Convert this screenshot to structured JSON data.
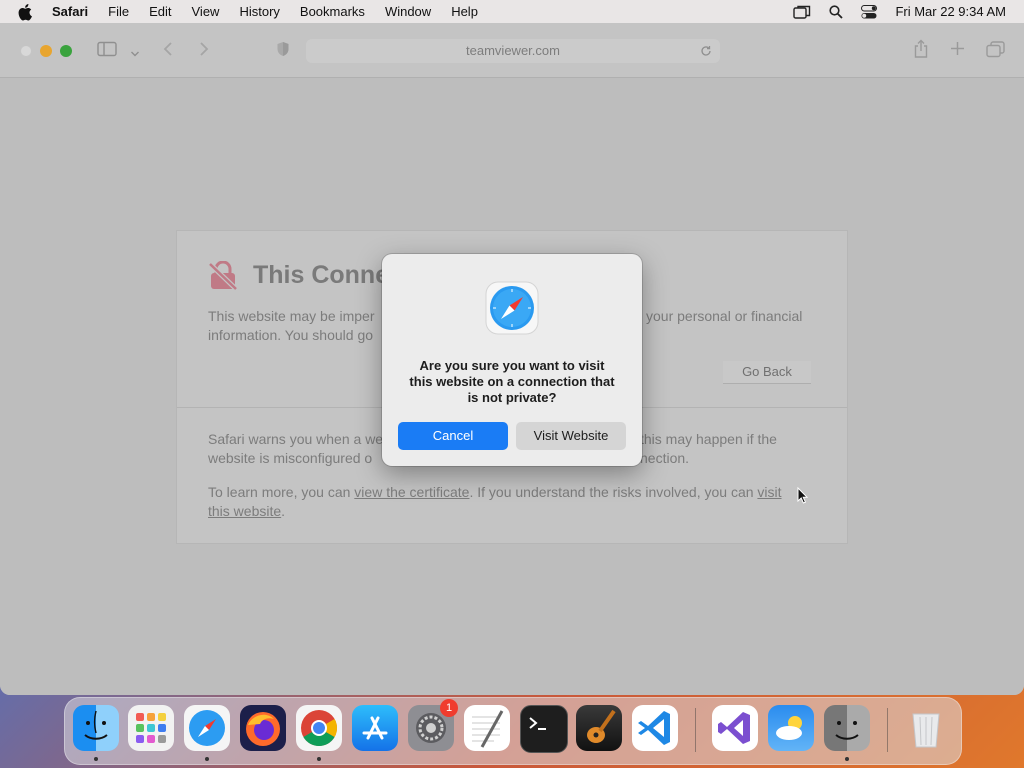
{
  "menubar": {
    "app_name": "Safari",
    "items": [
      "File",
      "Edit",
      "View",
      "History",
      "Bookmarks",
      "Window",
      "Help"
    ],
    "clock": "Fri Mar 22  9:34 AM"
  },
  "toolbar": {
    "address": "teamviewer.com"
  },
  "warning_page": {
    "title": "This Conne",
    "para1_line1_left": "This website may be imper",
    "para1_line1_right": "your personal or financial",
    "para1_line2_left": "information. You should go",
    "go_back_label": "Go Back",
    "para2_line1_left": "Safari warns you when a we",
    "para2_line1_right": "this may happen if the",
    "para2_line2_left": "website is misconfigured o",
    "para2_line2_right": "nection.",
    "learn_prefix": "To learn more, you can ",
    "view_cert_link": "view the certificate",
    "learn_middle": ". If you understand the risks involved, you can ",
    "visit_link_part1": "visit",
    "visit_link_part2": "this website",
    "learn_suffix": "."
  },
  "dialog": {
    "message_line1": "Are you sure you want to visit",
    "message_line2": "this website on a connection that",
    "message_line3": "is not private?",
    "cancel_label": "Cancel",
    "visit_label": "Visit Website"
  },
  "dock": {
    "apps": [
      "finder",
      "launchpad",
      "safari",
      "firefox",
      "chrome",
      "app-store",
      "system-settings",
      "textedit",
      "terminal",
      "garageband",
      "vscode",
      "visual-studio",
      "weather",
      "finder-2",
      "trash"
    ],
    "settings_badge": "1"
  }
}
